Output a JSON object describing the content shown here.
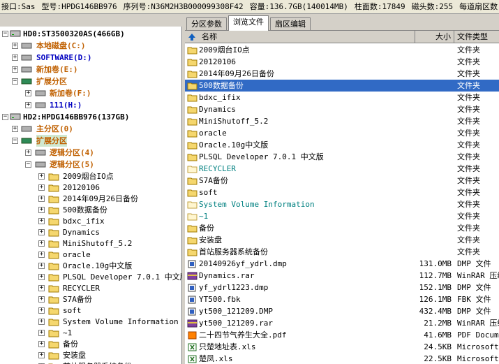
{
  "statusbar": {
    "interface": "接口:Sas",
    "model": "型号:HPDG146BB976",
    "serial": "序列号:N36M2H3B000099308F42",
    "capacity": "容量:136.7GB(140014MB)",
    "cylinders": "柱面数:17849",
    "heads": "磁头数:255",
    "sectors_per_track": "每道扇区数:"
  },
  "tree": {
    "hd0": "HD0:ST3500320AS(466GB)",
    "hd0_c": "本地磁盘(C:)",
    "hd0_d": "SOFTWARE(D:)",
    "hd0_e": "新加卷(E:)",
    "hd0_ext": "扩展分区",
    "hd0_f": "新加卷(F:)",
    "hd0_h": "111(H:)",
    "hd2": "HD2:HPDG146BB976(137GB)",
    "hd2_primary": "主分区(0)",
    "hd2_ext": "扩展分区",
    "hd2_logical4": "逻辑分区(4)",
    "hd2_logical5": "逻辑分区(5)",
    "folders": [
      "2009烟台IO点",
      "20120106",
      "2014年09月26日备份",
      "500数据备份",
      "bdxc_ifix",
      "Dynamics",
      "MiniShutoff_5.2",
      "oracle",
      "Oracle.10g中文版",
      "PLSQL Developer 7.0.1 中文版",
      "RECYCLER",
      "S7A备份",
      "soft",
      "System Volume Information",
      "~1",
      "备份",
      "安装盘",
      "首站服务器系统备份"
    ]
  },
  "tabs": [
    "分区参数",
    "浏览文件",
    "扇区编辑"
  ],
  "list": {
    "col_name": "名称",
    "col_size": "大小",
    "col_type": "文件类型",
    "rows": [
      {
        "name": "2009烟台IO点",
        "size": "",
        "type": "文件夹",
        "icon": "folder"
      },
      {
        "name": "20120106",
        "size": "",
        "type": "文件夹",
        "icon": "folder"
      },
      {
        "name": "2014年09月26日备份",
        "size": "",
        "type": "文件夹",
        "icon": "folder"
      },
      {
        "name": "500数据备份",
        "size": "",
        "type": "文件夹",
        "icon": "folder",
        "selected": true
      },
      {
        "name": "bdxc_ifix",
        "size": "",
        "type": "文件夹",
        "icon": "folder"
      },
      {
        "name": "Dynamics",
        "size": "",
        "type": "文件夹",
        "icon": "folder"
      },
      {
        "name": "MiniShutoff_5.2",
        "size": "",
        "type": "文件夹",
        "icon": "folder"
      },
      {
        "name": "oracle",
        "size": "",
        "type": "文件夹",
        "icon": "folder"
      },
      {
        "name": "Oracle.10g中文版",
        "size": "",
        "type": "文件夹",
        "icon": "folder"
      },
      {
        "name": "PLSQL Developer 7.0.1 中文版",
        "size": "",
        "type": "文件夹",
        "icon": "folder"
      },
      {
        "name": "RECYCLER",
        "size": "",
        "type": "文件夹",
        "icon": "folder-hidden",
        "cyan": true
      },
      {
        "name": "S7A备份",
        "size": "",
        "type": "文件夹",
        "icon": "folder"
      },
      {
        "name": "soft",
        "size": "",
        "type": "文件夹",
        "icon": "folder"
      },
      {
        "name": "System Volume Information",
        "size": "",
        "type": "文件夹",
        "icon": "folder-hidden",
        "cyan": true
      },
      {
        "name": "~1",
        "size": "",
        "type": "文件夹",
        "icon": "folder-hidden",
        "cyan": true
      },
      {
        "name": "备份",
        "size": "",
        "type": "文件夹",
        "icon": "folder"
      },
      {
        "name": "安装盘",
        "size": "",
        "type": "文件夹",
        "icon": "folder"
      },
      {
        "name": "首站服务器系统备份",
        "size": "",
        "type": "文件夹",
        "icon": "folder"
      },
      {
        "name": "20140926yf_ydrl.dmp",
        "size": "131.0MB",
        "type": "DMP 文件",
        "icon": "file"
      },
      {
        "name": "Dynamics.rar",
        "size": "112.7MB",
        "type": "WinRAR 压缩",
        "icon": "rar"
      },
      {
        "name": "yf_ydrl1223.dmp",
        "size": "152.1MB",
        "type": "DMP 文件",
        "icon": "file"
      },
      {
        "name": "YT500.fbk",
        "size": "126.1MB",
        "type": "FBK 文件",
        "icon": "file"
      },
      {
        "name": "yt500_121209.DMP",
        "size": "432.4MB",
        "type": "DMP 文件",
        "icon": "file"
      },
      {
        "name": "yt500_121209.rar",
        "size": "21.2MB",
        "type": "WinRAR 压缩",
        "icon": "rar"
      },
      {
        "name": "二十四节气养生大全.pdf",
        "size": "41.6MB",
        "type": "PDF Docume",
        "icon": "pdf"
      },
      {
        "name": "只楚地址表.xls",
        "size": "24.5KB",
        "type": "Microsoft",
        "icon": "xls"
      },
      {
        "name": "楚凤.xls",
        "size": "22.5KB",
        "type": "Microsoft",
        "icon": "xls"
      }
    ]
  }
}
